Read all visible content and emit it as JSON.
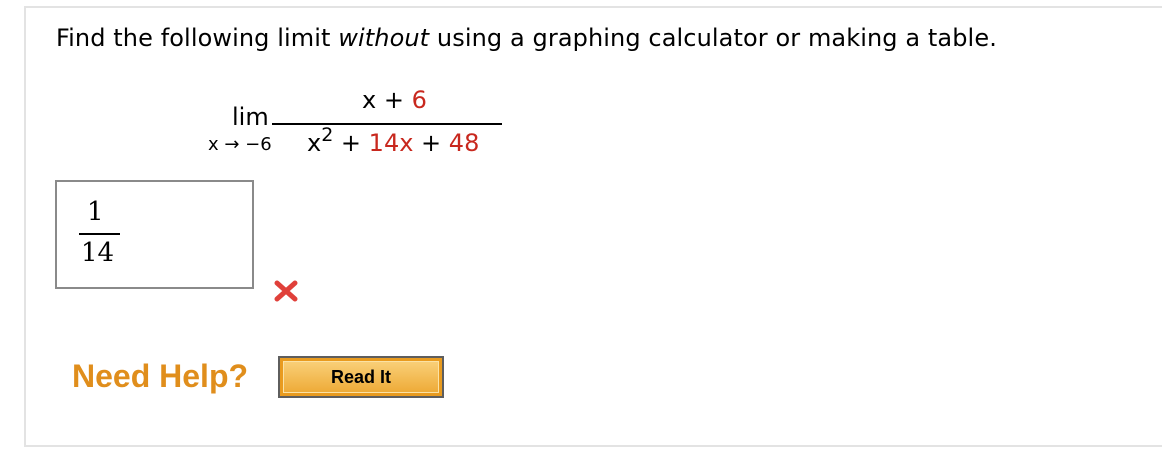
{
  "question": {
    "text_before": "Find the following limit ",
    "text_italic": "without",
    "text_after": " using a graphing calculator or making a table."
  },
  "limit": {
    "lim_word": "lim",
    "approach": "x → −6",
    "numerator_var": "x",
    "numerator_op": " + ",
    "numerator_const": "6",
    "denominator_var": "x",
    "denominator_exp": "2",
    "denominator_op1": " + ",
    "denominator_term2": "14x",
    "denominator_op2": " + ",
    "denominator_const": "48"
  },
  "answer": {
    "numerator": "1",
    "denominator": "14",
    "status_icon": "x-mark-icon",
    "status_color": "#e0403a"
  },
  "help": {
    "label": "Need Help?",
    "read_it_label": "Read It",
    "label_color": "#e08e1c",
    "button_color": "#e99b1f"
  }
}
